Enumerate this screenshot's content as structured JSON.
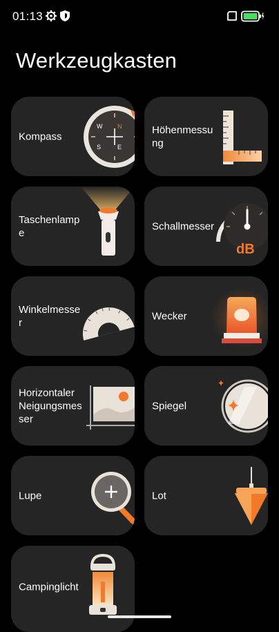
{
  "status_bar": {
    "time": "01:13"
  },
  "page": {
    "title": "Werkzeugkasten"
  },
  "tools": [
    {
      "label": "Kompass"
    },
    {
      "label": "Höhenmessung"
    },
    {
      "label": "Taschenlampe"
    },
    {
      "label": "Schallmesser"
    },
    {
      "label": "Winkelmesser"
    },
    {
      "label": "Wecker"
    },
    {
      "label": "Horizontaler Neigungsmesser"
    },
    {
      "label": "Spiegel"
    },
    {
      "label": "Lupe"
    },
    {
      "label": "Lot"
    },
    {
      "label": "Campinglicht"
    }
  ],
  "compass_letters": {
    "n": "N",
    "w": "W",
    "s": "S",
    "e": "E"
  },
  "sound_unit": "dB",
  "colors": {
    "accent": "#f07a2a",
    "card": "#252525",
    "background": "#000000",
    "battery": "#4cd964"
  }
}
